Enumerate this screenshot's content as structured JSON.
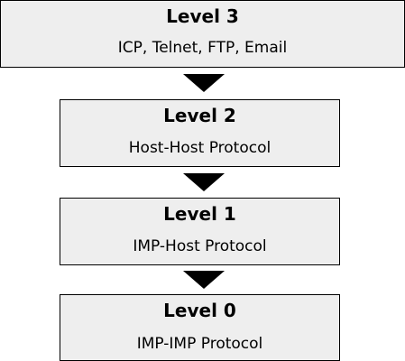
{
  "levels": [
    {
      "title": "Level 3",
      "subtitle": "ICP, Telnet, FTP, Email"
    },
    {
      "title": "Level 2",
      "subtitle": "Host-Host Protocol"
    },
    {
      "title": "Level 1",
      "subtitle": "IMP-Host Protocol"
    },
    {
      "title": "Level 0",
      "subtitle": "IMP-IMP Protocol"
    }
  ],
  "colors": {
    "box_fill": "#eeeeee",
    "box_border": "#000000",
    "arrow": "#000000",
    "background": "#ffffff"
  },
  "arrows": [
    {
      "from": "Level 3",
      "to": "Level 2",
      "icon": "down-triangle-arrow-icon"
    },
    {
      "from": "Level 2",
      "to": "Level 1",
      "icon": "down-triangle-arrow-icon"
    },
    {
      "from": "Level 1",
      "to": "Level 0",
      "icon": "down-triangle-arrow-icon"
    }
  ]
}
